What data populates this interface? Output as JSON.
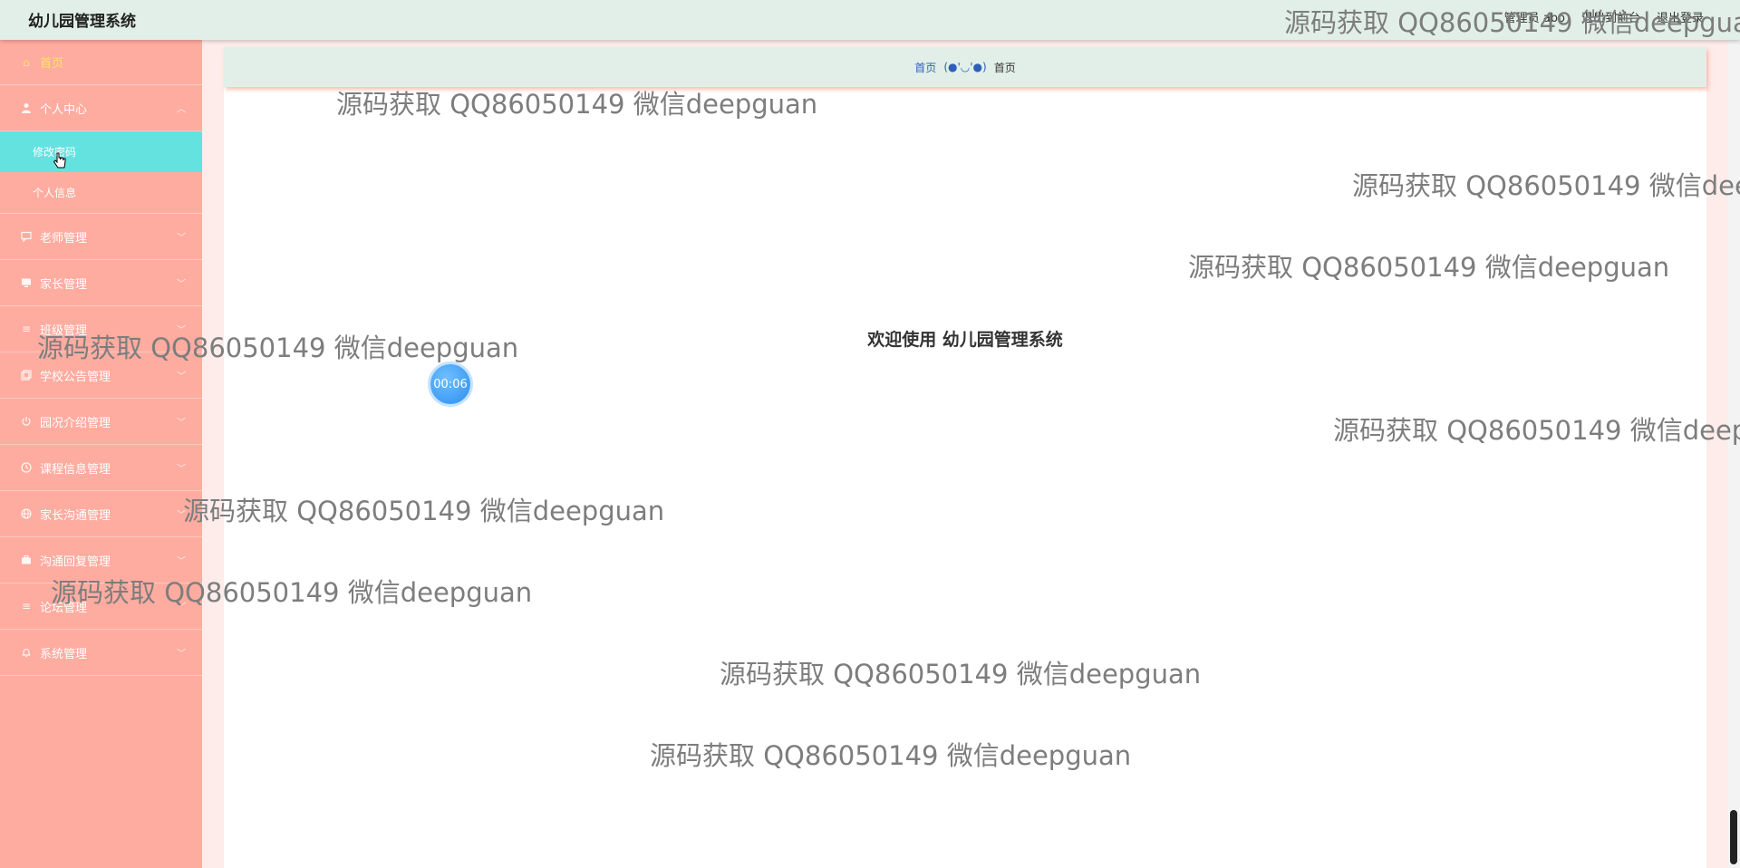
{
  "app": {
    "title": "幼儿园管理系统"
  },
  "topbar": {
    "user_label": "管理员 abo",
    "exit_to_front": "退出到前台",
    "logout": "退出登录"
  },
  "sidebar": {
    "home": "首页",
    "personal_center": "个人中心",
    "personal_sub": [
      "修改密码",
      "个人信息"
    ],
    "items": [
      {
        "label": "老师管理",
        "icon": "chat-icon"
      },
      {
        "label": "家长管理",
        "icon": "monitor-icon"
      },
      {
        "label": "班级管理",
        "icon": "list-icon"
      },
      {
        "label": "学校公告管理",
        "icon": "copy-icon"
      },
      {
        "label": "园况介绍管理",
        "icon": "power-icon"
      },
      {
        "label": "课程信息管理",
        "icon": "clock-icon"
      },
      {
        "label": "家长沟通管理",
        "icon": "globe-icon"
      },
      {
        "label": "沟通回复管理",
        "icon": "briefcase-icon"
      },
      {
        "label": "论坛管理",
        "icon": "list-icon"
      },
      {
        "label": "系统管理",
        "icon": "bell-icon"
      }
    ]
  },
  "breadcrumb": {
    "home": "首页",
    "separator": "(●'◡'●)",
    "current": "首页"
  },
  "welcome": "欢迎使用 幼儿园管理系统",
  "timer": "00:06",
  "watermark": "源码获取 QQ86050149 微信deepguan",
  "colors": {
    "sidebar_bg": "#ffaca0",
    "active_item_bg": "#63e2df",
    "home_text": "#ffe564",
    "topbar_bg": "#e1efe8"
  }
}
